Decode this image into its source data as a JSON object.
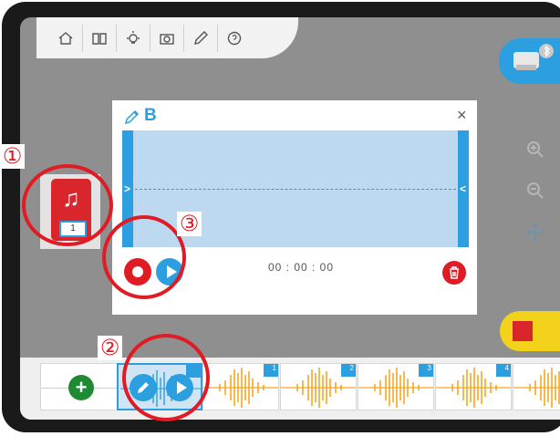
{
  "dialog": {
    "name": "B",
    "time": "00 : 00 : 00",
    "close_glyph": "×"
  },
  "toolbar": {
    "icons": [
      "home-icon",
      "book-icon",
      "lightbulb-icon",
      "camera-icon",
      "pencil-icon",
      "help-icon"
    ]
  },
  "sound_block": {
    "number": "1",
    "icon": "music-note-icon",
    "color": "#d8262c"
  },
  "timeline": {
    "add_label": "+",
    "slots": [
      {
        "number": ""
      },
      {
        "number": "1"
      },
      {
        "number": "2"
      },
      {
        "number": "3"
      },
      {
        "number": "4"
      },
      {
        "number": ""
      }
    ]
  },
  "annotations": {
    "one": "①",
    "two": "②",
    "three": "③"
  },
  "colors": {
    "accent_blue": "#2b9fe0",
    "record_red": "#e01b24",
    "wave_orange": "#f5a623",
    "stop_yellow": "#f2d21a",
    "add_green": "#1e8a33"
  }
}
